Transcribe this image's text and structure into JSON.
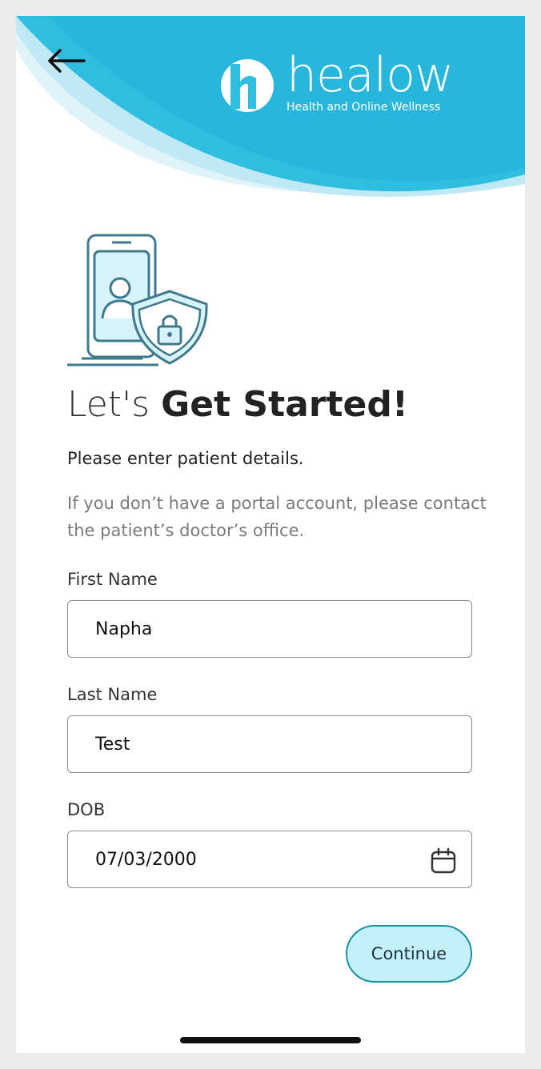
{
  "header": {
    "back_icon": "arrow-left-icon",
    "logo_text": "healow",
    "logo_tagline": "Health and Online Wellness"
  },
  "hero": {
    "illustration_icon": "phone-shield-lock-icon",
    "title_light": "Let's",
    "title_bold": "Get Started!",
    "subtitle": "Please enter patient details.",
    "note": "If you don’t have a portal account, please contact the patient’s doctor’s office."
  },
  "form": {
    "first_name": {
      "label": "First Name",
      "value": "Napha"
    },
    "last_name": {
      "label": "Last Name",
      "value": "Test"
    },
    "dob": {
      "label": "DOB",
      "value": "07/03/2000",
      "icon": "calendar-icon"
    }
  },
  "actions": {
    "continue_label": "Continue"
  },
  "colors": {
    "header_blue": "#2fbde0",
    "header_light": "#bfeaf5",
    "button_fill": "#c2f1fb",
    "button_border": "#1a8fa8"
  }
}
